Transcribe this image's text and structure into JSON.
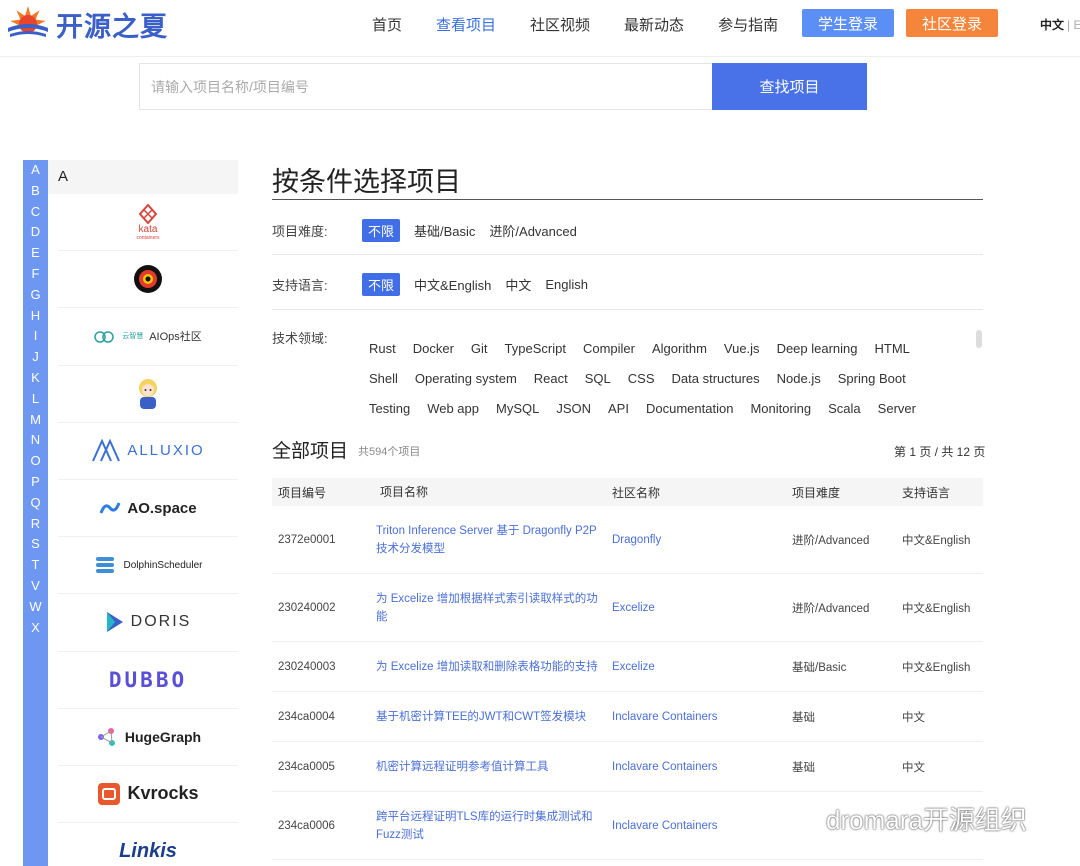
{
  "header": {
    "logo_text": "开源之夏",
    "nav": [
      "首页",
      "查看项目",
      "社区视频",
      "最新动态",
      "参与指南"
    ],
    "active_nav": "查看项目",
    "student_login": "学生登录",
    "community_login": "社区登录",
    "lang": "中文",
    "lang_sep": "| E"
  },
  "search": {
    "placeholder": "请输入项目名称/项目编号",
    "button": "查找项目"
  },
  "alphabet": [
    "A",
    "B",
    "C",
    "D",
    "E",
    "F",
    "G",
    "H",
    "I",
    "J",
    "K",
    "L",
    "M",
    "N",
    "O",
    "P",
    "Q",
    "R",
    "S",
    "T",
    "V",
    "W",
    "X"
  ],
  "community_list": {
    "header": "A",
    "items": [
      {
        "name": "kata",
        "sub": "containers"
      },
      {
        "name": "",
        "sub": ""
      },
      {
        "name": "AIOps社区",
        "prefix": "云智慧"
      },
      {
        "name": "",
        "sub": ""
      },
      {
        "name": "ALLUXIO"
      },
      {
        "name": "AO.space"
      },
      {
        "name": "DolphinScheduler"
      },
      {
        "name": "DORIS"
      },
      {
        "name": "DUBBO"
      },
      {
        "name": "HugeGraph"
      },
      {
        "name": "Kvrocks"
      },
      {
        "name": "Linkis"
      }
    ]
  },
  "filters": {
    "title": "按条件选择项目",
    "difficulty": {
      "label": "项目难度:",
      "options": [
        "不限",
        "基础/Basic",
        "进阶/Advanced"
      ],
      "selected": "不限"
    },
    "language": {
      "label": "支持语言:",
      "options": [
        "不限",
        "中文&English",
        "中文",
        "English"
      ],
      "selected": "不限"
    },
    "tech": {
      "label": "技术领域:",
      "rows": [
        [
          "Rust",
          "Docker",
          "Git",
          "TypeScript",
          "Compiler",
          "Algorithm",
          "Vue.js",
          "Deep learning",
          "HTML"
        ],
        [
          "Shell",
          "Operating system",
          "React",
          "SQL",
          "CSS",
          "Data structures",
          "Node.js",
          "Spring Boot"
        ],
        [
          "Testing",
          "Web app",
          "MySQL",
          "JSON",
          "API",
          "Documentation",
          "Monitoring",
          "Scala",
          "Server"
        ]
      ]
    }
  },
  "projects": {
    "title": "全部项目",
    "count": "共594个项目",
    "pager": "第 1 页 / 共 12 页",
    "columns": [
      "项目编号",
      "项目名称",
      "社区名称",
      "项目难度",
      "支持语言"
    ],
    "rows": [
      {
        "id": "2372e0001",
        "name": "Triton Inference Server 基于 Dragonfly P2P 技术分发模型",
        "community": "Dragonfly",
        "difficulty": "进阶/Advanced",
        "lang": "中文&English"
      },
      {
        "id": "230240002",
        "name": "为 Excelize 增加根据样式索引读取样式的功能",
        "community": "Excelize",
        "difficulty": "进阶/Advanced",
        "lang": "中文&English"
      },
      {
        "id": "230240003",
        "name": "为 Excelize 增加读取和删除表格功能的支持",
        "community": "Excelize",
        "difficulty": "基础/Basic",
        "lang": "中文&English"
      },
      {
        "id": "234ca0004",
        "name": "基于机密计算TEE的JWT和CWT签发模块",
        "community": "Inclavare Containers",
        "difficulty": "基础",
        "lang": "中文"
      },
      {
        "id": "234ca0005",
        "name": "机密计算远程证明参考值计算工具",
        "community": "Inclavare Containers",
        "difficulty": "基础",
        "lang": "中文"
      },
      {
        "id": "234ca0006",
        "name": "跨平台远程证明TLS库的运行时集成测试和Fuzz测试",
        "community": "Inclavare Containers",
        "difficulty": "",
        "lang": ""
      }
    ]
  },
  "watermark": "dromara开源组织"
}
